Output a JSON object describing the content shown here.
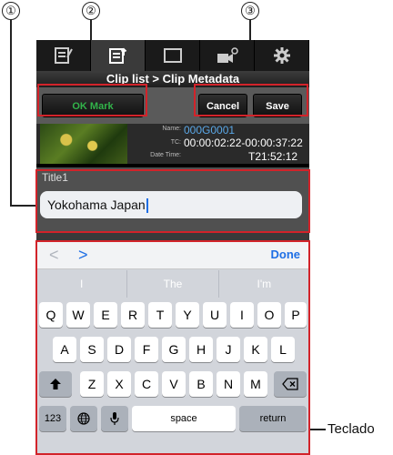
{
  "callouts": [
    "①",
    "②",
    "③"
  ],
  "tabs": [
    {
      "icon": "memo-icon",
      "active": false
    },
    {
      "icon": "clip-list-icon",
      "active": true
    },
    {
      "icon": "display-icon",
      "active": false
    },
    {
      "icon": "camera-settings-icon",
      "active": false
    },
    {
      "icon": "gear-icon",
      "active": false
    }
  ],
  "breadcrumb": "Clip list > Clip Metadata",
  "buttons": {
    "ok_mark": "OK Mark",
    "cancel": "Cancel",
    "save": "Save"
  },
  "metadata": {
    "name_label": "Name:",
    "name_value": "000G0001",
    "tc_label": "TC:",
    "tc_value": "00:00:02:22-00:00:37:22",
    "date_label": "Date Time:",
    "date_value": "T21:52:12"
  },
  "title_field": {
    "label": "Title1",
    "value": "Yokohama Japan"
  },
  "keyboard": {
    "nav_prev": "<",
    "nav_next": ">",
    "done": "Done",
    "suggestions": [
      "I",
      "The",
      "I'm"
    ],
    "row1": [
      "Q",
      "W",
      "E",
      "R",
      "T",
      "Y",
      "U",
      "I",
      "O",
      "P"
    ],
    "row2": [
      "A",
      "S",
      "D",
      "F",
      "G",
      "H",
      "J",
      "K",
      "L"
    ],
    "row3": [
      "Z",
      "X",
      "C",
      "V",
      "B",
      "N",
      "M"
    ],
    "numbers": "123",
    "space": "space",
    "return": "return"
  },
  "outer_label": "Teclado",
  "colors": {
    "highlight": "#d2232a",
    "ok_green": "#32b34a",
    "accent_blue": "#1f6fe5"
  }
}
